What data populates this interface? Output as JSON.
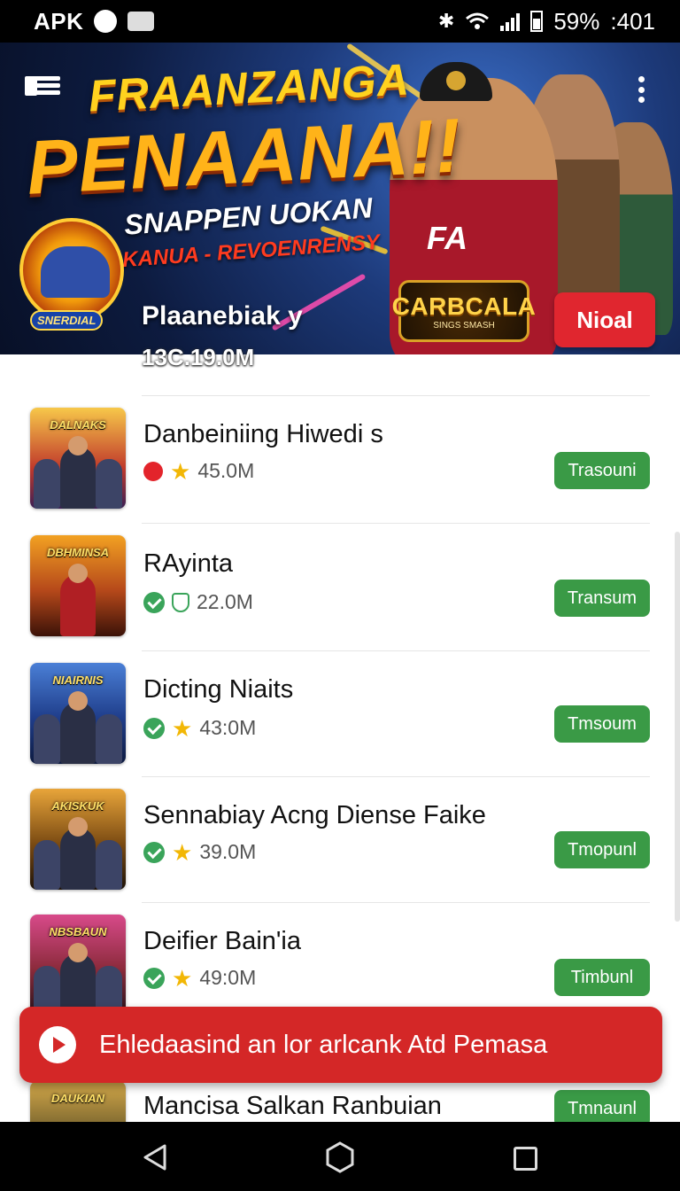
{
  "status_bar": {
    "app_label": "APK",
    "battery": "59%",
    "time": ":401"
  },
  "banner": {
    "title_line1": "FRAANZANGA",
    "title_line2": "PENAANA!!",
    "subtitle": "SNAPPEN UOKAN",
    "subtitle2": "KANUA - REVOENRENSY",
    "jersey_text": "FA",
    "badge_title": "CARBCALA",
    "badge_sub": "SINGS SMASH",
    "cta_label": "Nioal",
    "logo_caption": "SNERDIAL"
  },
  "featured": {
    "name": "Plaanebiak y",
    "meta": "13C.19.0M"
  },
  "apps": [
    {
      "title": "Danbeiniing Hiwedi s",
      "thumb_label": "DALNAKS",
      "rating_value": "45.0M",
      "badge_icon": "red-dot-icon",
      "rating_icon": "star-icon",
      "button": "Trasouni",
      "thumb_color": "#c0392b"
    },
    {
      "title": "RAyinta",
      "thumb_label": "DBHMINSA",
      "rating_value": "22.0M",
      "badge_icon": "check-icon",
      "rating_icon": "shield-icon",
      "button": "Transum",
      "thumb_color": "#b5481a"
    },
    {
      "title": "Dicting Niaits",
      "thumb_label": "NIAIRNIS",
      "rating_value": "43:0M",
      "badge_icon": "check-icon",
      "rating_icon": "star-icon",
      "button": "Tmsoum",
      "thumb_color": "#1f3d8a"
    },
    {
      "title": "Sennabiay Acng Diense Faike",
      "thumb_label": "AKISKUK",
      "rating_value": "39.0M",
      "badge_icon": "check-icon",
      "rating_icon": "star-icon",
      "button": "Tmopunl",
      "thumb_color": "#7a4a12"
    },
    {
      "title": "Deifier Bain'ia",
      "thumb_label": "NBSBAUN",
      "rating_value": "49:0M",
      "badge_icon": "check-icon",
      "rating_icon": "star-icon",
      "button": "Timbunl",
      "thumb_color": "#8a2a3a"
    },
    {
      "title": "Mancisa Salkan Ranbuian",
      "thumb_label": "DAUKIAN",
      "rating_value": "",
      "badge_icon": "",
      "rating_icon": "",
      "button": "Tmnaunl",
      "thumb_color": "#6b5a2a"
    }
  ],
  "toast": {
    "text": "Ehledaasind  an lor arlcank Atd Pemasa",
    "icon": "play-icon"
  },
  "nav": {
    "back_icon": "back-triangle-icon",
    "home_icon": "home-hexagon-icon",
    "recents_icon": "recents-square-icon"
  },
  "colors": {
    "accent_green": "#3a9a46",
    "cta_red": "#e0262f",
    "toast_red": "#d42727"
  }
}
